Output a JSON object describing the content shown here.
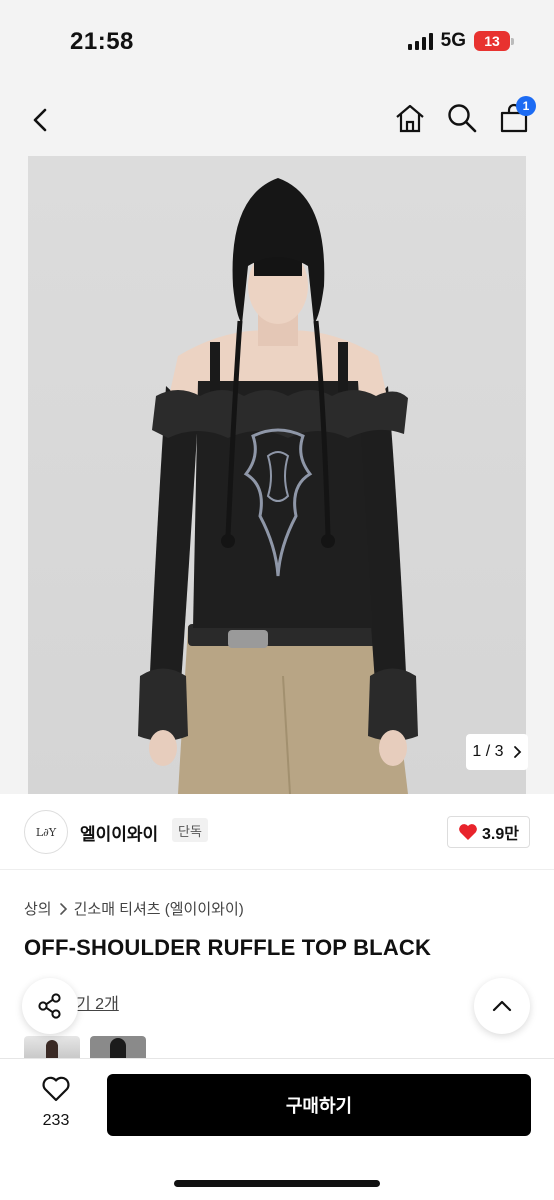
{
  "status_bar": {
    "time": "21:58",
    "network": "5G",
    "battery": "13"
  },
  "nav": {
    "cart_count": "1",
    "icons": [
      "chevron-left-icon",
      "home-icon",
      "search-icon",
      "cart-icon"
    ]
  },
  "gallery": {
    "page_current": "1",
    "page_total": "3",
    "page_label": "1 / 3"
  },
  "brand": {
    "logo_text": "L∂Y",
    "name": "엘이이와이",
    "tag": "단독",
    "likes": "3.9만"
  },
  "product": {
    "breadcrumb": [
      "상의",
      "긴소매 티셔츠 (엘이이와이)"
    ],
    "title": "OFF-SHOULDER RUFFLE TOP BLACK",
    "review_link": "기 2개"
  },
  "bottom": {
    "wish_count": "233",
    "buy_label": "구매하기"
  },
  "colors": {
    "accent_badge": "#1c6bf3",
    "heart": "#e8232b",
    "battery": "#e8322f",
    "buy_button": "#000000"
  }
}
